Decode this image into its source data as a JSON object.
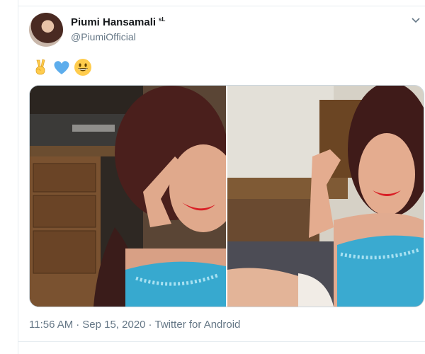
{
  "tweet": {
    "display_name": "Piumi Hansamali",
    "badge": "sL",
    "handle": "@PiumiOfficial",
    "emojis": [
      "victory-hand",
      "blue-heart",
      "grinning-face"
    ],
    "time": "11:56 AM",
    "separator": "·",
    "date": "Sep 15, 2020",
    "source": "Twitter for Android"
  },
  "photos": [
    {
      "name": "selfie-covering-eye"
    },
    {
      "name": "selfie-seated-smile"
    }
  ],
  "colors": {
    "text_primary": "#14171a",
    "text_secondary": "#657786",
    "border": "#e6ecf0",
    "heart_blue": "#5dadec",
    "emoji_yellow": "#ffcc4d"
  }
}
